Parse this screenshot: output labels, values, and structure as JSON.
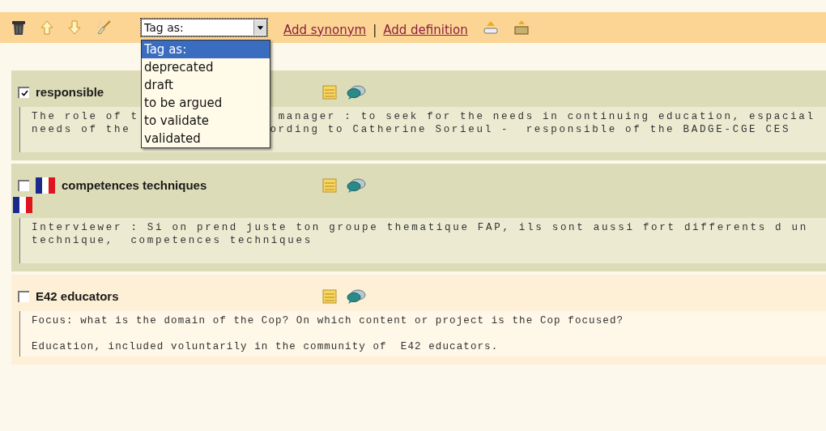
{
  "toolbar": {
    "tag_select": {
      "value": "Tag as:",
      "expanded": true,
      "options": [
        {
          "label": "Tag as:",
          "selected": true
        },
        {
          "label": "deprecated",
          "selected": false
        },
        {
          "label": "draft",
          "selected": false
        },
        {
          "label": "to be argued",
          "selected": false
        },
        {
          "label": "to validate",
          "selected": false
        },
        {
          "label": "validated",
          "selected": false
        }
      ]
    },
    "links": [
      "Add synonym",
      "Add definition"
    ],
    "separator": "|"
  },
  "entries": [
    {
      "kind": "green",
      "checked": true,
      "title": "responsible",
      "flag_before_title": false,
      "flag_line": false,
      "spaced_lines": false,
      "description": [
        [
          "The role of t",
          "manager : to seek for the needs in continuing education, espacial"
        ],
        [
          "needs of the",
          "ording to Catherine Sorieul -  responsible of the BADGE-CGE CES"
        ]
      ]
    },
    {
      "kind": "green",
      "checked": false,
      "title": "competences techniques",
      "flag_before_title": true,
      "flag_line": true,
      "spaced_lines": false,
      "description": [
        [
          "Interviewer : Si on prend juste ton groupe thematique FAP, ils sont aussi fort differents d un"
        ],
        [
          "technique,  competences techniques"
        ]
      ]
    },
    {
      "kind": "cream",
      "checked": false,
      "title": "E42 educators",
      "flag_before_title": false,
      "flag_line": false,
      "spaced_lines": true,
      "description": [
        [
          "Focus: what is the domain of the Cop? On which content or project is the Cop focused?"
        ],
        [
          "Education, included voluntarily in the community of  E42 educators."
        ]
      ]
    }
  ]
}
